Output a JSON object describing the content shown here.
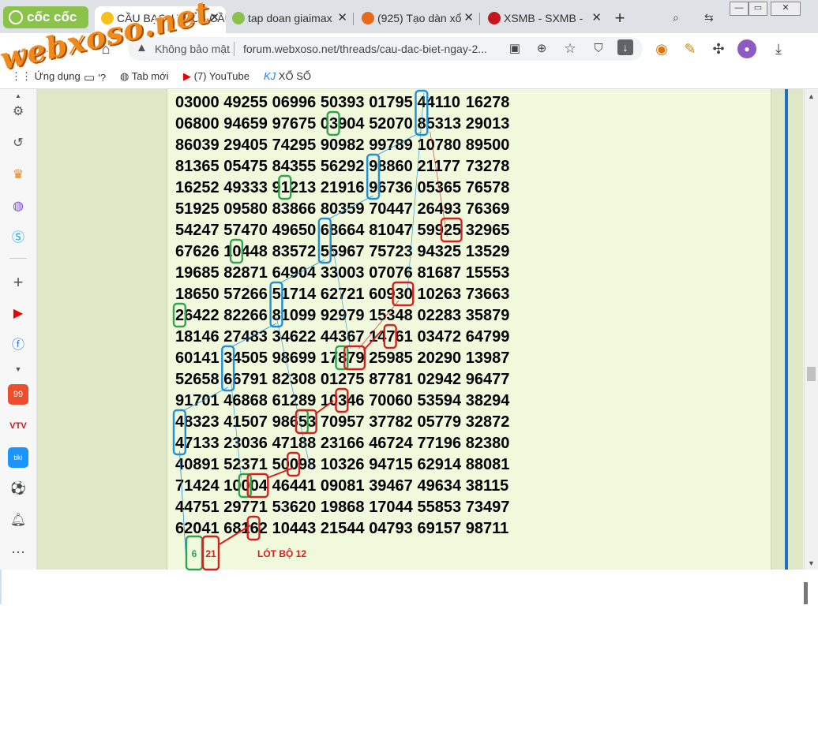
{
  "tabs": [
    {
      "label": "CẦU BẠCH THỦ - CẦU",
      "icon": "xoso-icon",
      "active": true
    },
    {
      "label": "tap doan giaimax",
      "icon": "leaf-icon"
    },
    {
      "label": "(925) Tạo dàn xổ",
      "icon": "firefox-icon"
    },
    {
      "label": "XSMB - SXMB -",
      "icon": "xs-icon"
    }
  ],
  "browser_brand": "cốc cốc",
  "toolbar": {
    "security_label": "Không bảo mật",
    "url": "forum.webxoso.net/threads/cau-dac-biet-ngay-2..."
  },
  "bookmarks": [
    {
      "label": "Ứng dụng",
      "icon": "apps-icon"
    },
    {
      "label": "'?",
      "icon": "folder-icon"
    },
    {
      "label": "Tab mới",
      "icon": "globe-icon"
    },
    {
      "label": "(7) YouTube",
      "icon": "youtube-icon"
    },
    {
      "label": "XỔ SỐ",
      "icon": "kj-icon"
    }
  ],
  "watermark": "webxoso.net",
  "grid_rows": [
    [
      "03000",
      "49255",
      "06996",
      "50393",
      "01795",
      "44110",
      "16278"
    ],
    [
      "06800",
      "94659",
      "97675",
      "03904",
      "52070",
      "85313",
      "29013"
    ],
    [
      "86039",
      "29405",
      "74295",
      "90982",
      "99789",
      "10780",
      "89500"
    ],
    [
      "81365",
      "05475",
      "84355",
      "56292",
      "98860",
      "21177",
      "73278"
    ],
    [
      "16252",
      "49333",
      "91213",
      "21916",
      "96736",
      "05365",
      "76578"
    ],
    [
      "51925",
      "09580",
      "83866",
      "80359",
      "70447",
      "26493",
      "76369"
    ],
    [
      "54247",
      "57470",
      "49650",
      "68664",
      "81047",
      "59925",
      "32965"
    ],
    [
      "67626",
      "10448",
      "83572",
      "55967",
      "75723",
      "94325",
      "13529"
    ],
    [
      "19685",
      "82871",
      "64904",
      "33003",
      "07076",
      "81687",
      "15553"
    ],
    [
      "18650",
      "57266",
      "51714",
      "62721",
      "60930",
      "10263",
      "73663"
    ],
    [
      "26422",
      "82266",
      "81099",
      "92979",
      "15348",
      "02283",
      "35879"
    ],
    [
      "18146",
      "27483",
      "34622",
      "44367",
      "14761",
      "03472",
      "64799"
    ],
    [
      "60141",
      "34505",
      "98699",
      "17879",
      "25985",
      "20290",
      "13987"
    ],
    [
      "52658",
      "66791",
      "82308",
      "01275",
      "87781",
      "02942",
      "96477"
    ],
    [
      "91701",
      "46868",
      "61289",
      "10346",
      "70060",
      "53594",
      "38294"
    ],
    [
      "48323",
      "41507",
      "98653",
      "70957",
      "37782",
      "05779",
      "32872"
    ],
    [
      "47133",
      "23036",
      "47188",
      "23166",
      "46724",
      "77196",
      "82380"
    ],
    [
      "40891",
      "52371",
      "50098",
      "10326",
      "94715",
      "62914",
      "88081"
    ],
    [
      "71424",
      "10004",
      "46441",
      "09081",
      "39467",
      "49634",
      "38115"
    ],
    [
      "44751",
      "29771",
      "53620",
      "19868",
      "17044",
      "55853",
      "73497"
    ],
    [
      "62041",
      "68162",
      "10443",
      "21544",
      "04793",
      "69157",
      "98711"
    ]
  ],
  "result_green": "6",
  "result_red": "21",
  "result_note": "LÓT BỘ 12",
  "colors": {
    "blue": "#1f8fd6",
    "green": "#2ea44f",
    "red": "#d61f1f",
    "post_bg": "#f1f9dd",
    "side_bg": "#dfe8c6"
  }
}
